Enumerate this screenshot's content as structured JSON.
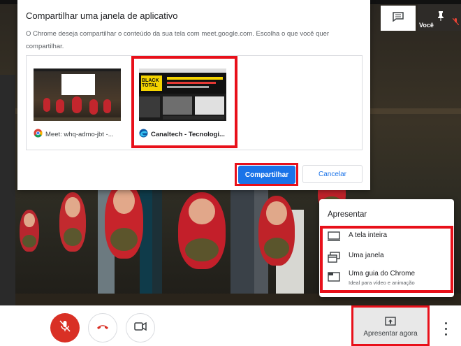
{
  "share_dialog": {
    "title": "Compartilhar uma janela de aplicativo",
    "description": "O Chrome deseja compartilhar o conteúdo da sua tela com meet.google.com. Escolha o que você quer compartilhar.",
    "windows": [
      {
        "label": "Meet: whq-admo-jbt -...",
        "icon": "chrome-icon",
        "selected": false
      },
      {
        "label": "Canaltech - Tecnologi...",
        "icon": "edge-icon",
        "selected": true,
        "thumb_text": "BLACK TOTAL"
      }
    ],
    "share_button": "Compartilhar",
    "cancel_button": "Cancelar"
  },
  "present_menu": {
    "title": "Apresentar",
    "items": [
      {
        "label": "A tela inteira",
        "icon": "monitor-icon"
      },
      {
        "label": "Uma janela",
        "icon": "window-icon"
      },
      {
        "label": "Uma guia do Chrome",
        "sublabel": "Ideal para vídeo e animação",
        "icon": "tab-icon"
      }
    ]
  },
  "self_tile": {
    "name": "Você"
  },
  "bottom_bar": {
    "present_now": "Apresentar agora"
  },
  "colors": {
    "accent": "#1a73e8",
    "highlight": "#e8101a",
    "danger": "#d93025"
  }
}
